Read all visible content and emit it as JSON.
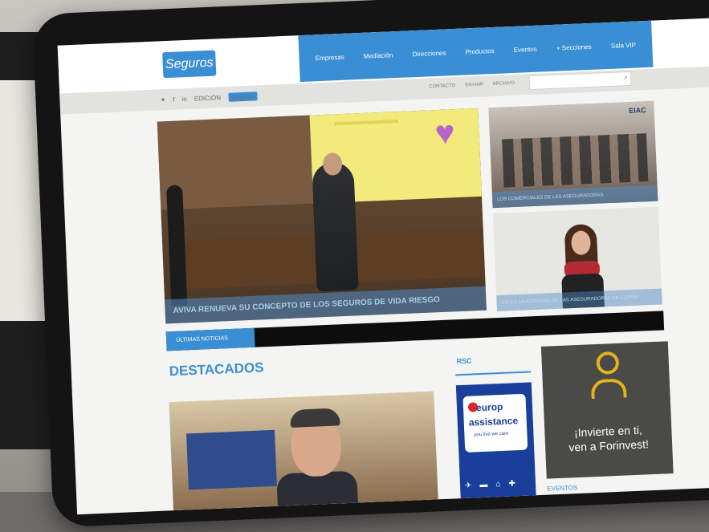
{
  "site": {
    "logo": "Seguros",
    "nav": [
      "Empresas",
      "Mediación",
      "Direcciones",
      "Productos",
      "Eventos",
      "+ Secciones",
      "Sala VIP"
    ],
    "social_tag": "EDICIÓN",
    "social_badge": "seguros",
    "top_links": [
      "CONTACTO",
      "ENVIAR",
      "ARCHIVO"
    ],
    "search": {
      "placeholder": ""
    }
  },
  "hero": {
    "caption": "AVIVA RENUEVA SU CONCEPTO DE LOS SEGUROS DE VIDA RIESGO"
  },
  "side_news": [
    {
      "badge": "EIAC",
      "caption": "LOS COMERCIALES DE LAS ASEGURADORAS"
    },
    {
      "caption": "ASÍ ES LA ACTIVIDAD DE LAS ASEGURADORAS EN ESPAÑA"
    }
  ],
  "ticker": {
    "label": "ÚLTIMAS NOTICIAS"
  },
  "destacados": {
    "title": "DESTACADOS"
  },
  "rsc": {
    "title": "RSC",
    "brand_line1": "europ",
    "brand_line2": "assistance",
    "tagline": "you live we care"
  },
  "ad": {
    "line1": "¡Invierte en ti,",
    "line2": "ven a Forinvest!"
  },
  "eventos": "EVENTOS",
  "colors": {
    "accent": "#3a8fd4",
    "ad_bg": "#4a4a48",
    "ad_icon": "#e6b21c",
    "rsc_bg": "#1a3f9a"
  }
}
